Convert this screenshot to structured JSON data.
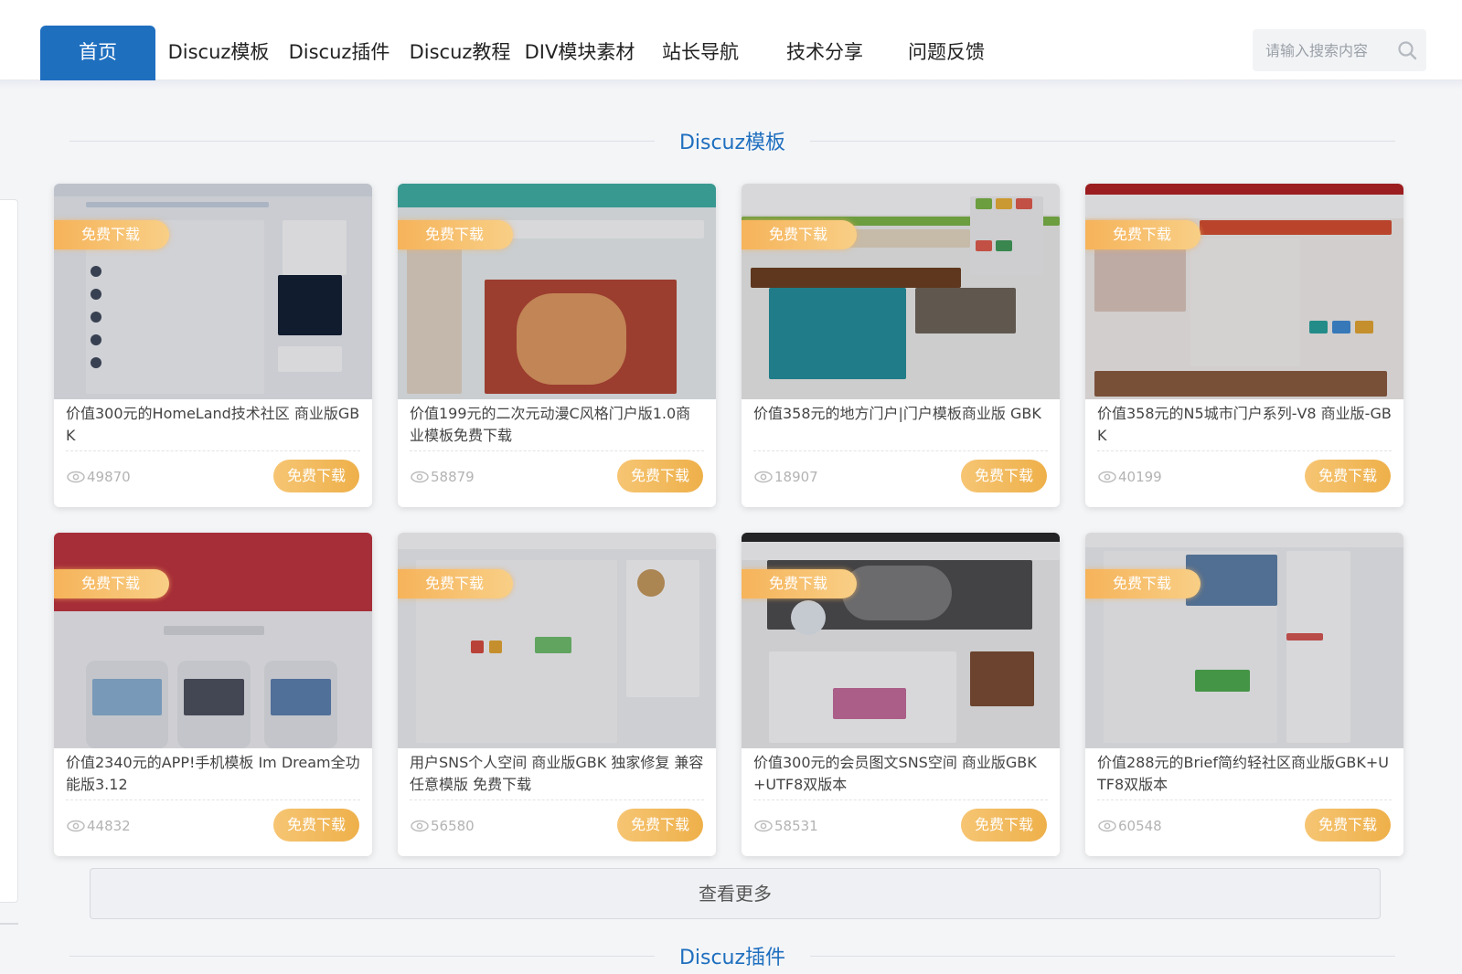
{
  "nav": {
    "items": [
      {
        "label": "首页",
        "active": true
      },
      {
        "label": "Discuz模板"
      },
      {
        "label": "Discuz插件"
      },
      {
        "label": "Discuz教程"
      },
      {
        "label": "DIV模块素材"
      },
      {
        "label": "站长导航"
      },
      {
        "label": "技术分享"
      },
      {
        "label": "问题反馈"
      }
    ]
  },
  "search": {
    "placeholder": "请输入搜索内容",
    "icon": "search-icon"
  },
  "sections": [
    {
      "title": "Discuz模板"
    },
    {
      "title": "Discuz插件"
    }
  ],
  "ribbon_label": "免费下载",
  "cards": [
    {
      "title": "价值300元的HomeLand技术社区 商业版GBK",
      "views": "49870",
      "button": "免费下载"
    },
    {
      "title": "价值199元的二次元动漫C风格门户版1.0商业模板免费下载",
      "views": "58879",
      "button": "免费下载"
    },
    {
      "title": "价值358元的地方门户|门户模板商业版 GBK",
      "views": "18907",
      "button": "免费下载"
    },
    {
      "title": "价值358元的N5城市门户系列-V8 商业版-GBK",
      "views": "40199",
      "button": "免费下载"
    },
    {
      "title": "价值2340元的APP!手机模板 Im Dream全功能版3.12",
      "views": "44832",
      "button": "免费下载"
    },
    {
      "title": "用户SNS个人空间 商业版GBK 独家修复 兼容任意模版 免费下载",
      "views": "56580",
      "button": "免费下载"
    },
    {
      "title": "价值300元的会员图文SNS空间 商业版GBK+UTF8双版本",
      "views": "58531",
      "button": "免费下载"
    },
    {
      "title": "价值288元的Brief简约轻社区商业版GBK+UTF8双版本",
      "views": "60548",
      "button": "免费下载"
    }
  ],
  "more_button": "查看更多",
  "colors": {
    "accent": "#1f6fbf",
    "button_gold": "#eeb04a",
    "ribbon_gold": "#f6b35a",
    "background": "#f4f5f7"
  }
}
